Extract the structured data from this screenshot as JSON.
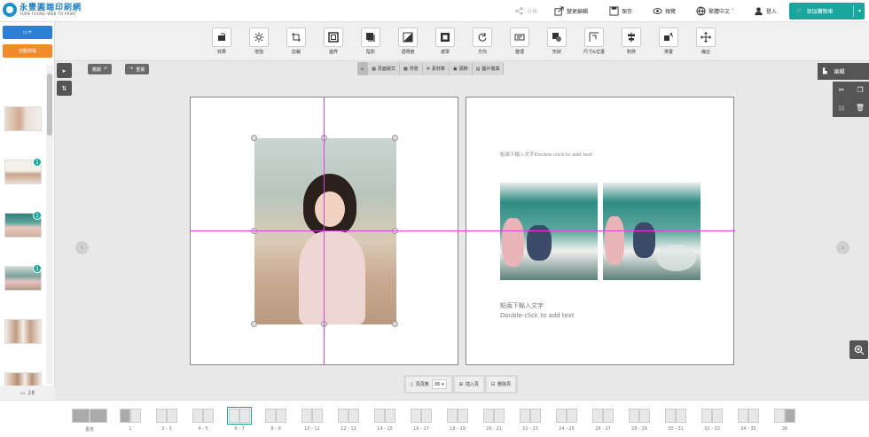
{
  "header": {
    "logo_cn": "永豐圓端印刷網",
    "logo_en": "YUEN FOONG WEB TO PRINT",
    "nav": [
      {
        "label": "分享",
        "dim": true
      },
      {
        "label": "變更編輯"
      },
      {
        "label": "保存"
      },
      {
        "label": "預覽"
      },
      {
        "label": "繁體中文 ˇ"
      },
      {
        "label": "登入"
      }
    ],
    "add_cart": "添加購物車"
  },
  "left": {
    "upload_label": "+",
    "auto_label": "自動排版",
    "photo_count": "28",
    "badges": [
      "1",
      "1",
      "1"
    ]
  },
  "toolbar": [
    {
      "label": "效果"
    },
    {
      "label": "增強"
    },
    {
      "label": "剪裁"
    },
    {
      "label": "邊界"
    },
    {
      "label": "陰影"
    },
    {
      "label": "透明度"
    },
    {
      "label": "遮罩"
    },
    {
      "label": "方向"
    },
    {
      "label": "整理"
    },
    {
      "label": "形狀"
    },
    {
      "label": "尺寸&位置"
    },
    {
      "label": "對齊"
    },
    {
      "label": "排置"
    },
    {
      "label": "縮合"
    }
  ],
  "actions": {
    "undo": "撤銷",
    "redo": "重做"
  },
  "modes": [
    "頁面版式",
    "背景",
    "素材庫",
    "頭飾",
    "圖片復填"
  ],
  "canvas": {
    "top_text": "點兩下輸入文字Double-click to add text",
    "bottom_text_1": "點兩下輸入文字",
    "bottom_text_2": "Double-click to add text"
  },
  "right": {
    "edit_tab": "編輯"
  },
  "pagecontrol": {
    "pages_label": "頁頁數",
    "pages_value": "36",
    "insert": "插入頁",
    "delete": "刪除頁"
  },
  "spreads": [
    "書皮",
    "1",
    "2 - 3",
    "4 - 5",
    "6 - 7",
    "8 - 9",
    "10 - 11",
    "12 - 13",
    "14 - 15",
    "16 - 17",
    "18 - 19",
    "20 - 21",
    "22 - 23",
    "24 - 25",
    "26 - 27",
    "28 - 29",
    "30 - 31",
    "32 - 33",
    "34 - 35",
    "36"
  ],
  "colors": {
    "accent": "#19a79d",
    "upload": "#2c7fd6",
    "auto": "#f08a2c",
    "guide": "#e040e0"
  }
}
